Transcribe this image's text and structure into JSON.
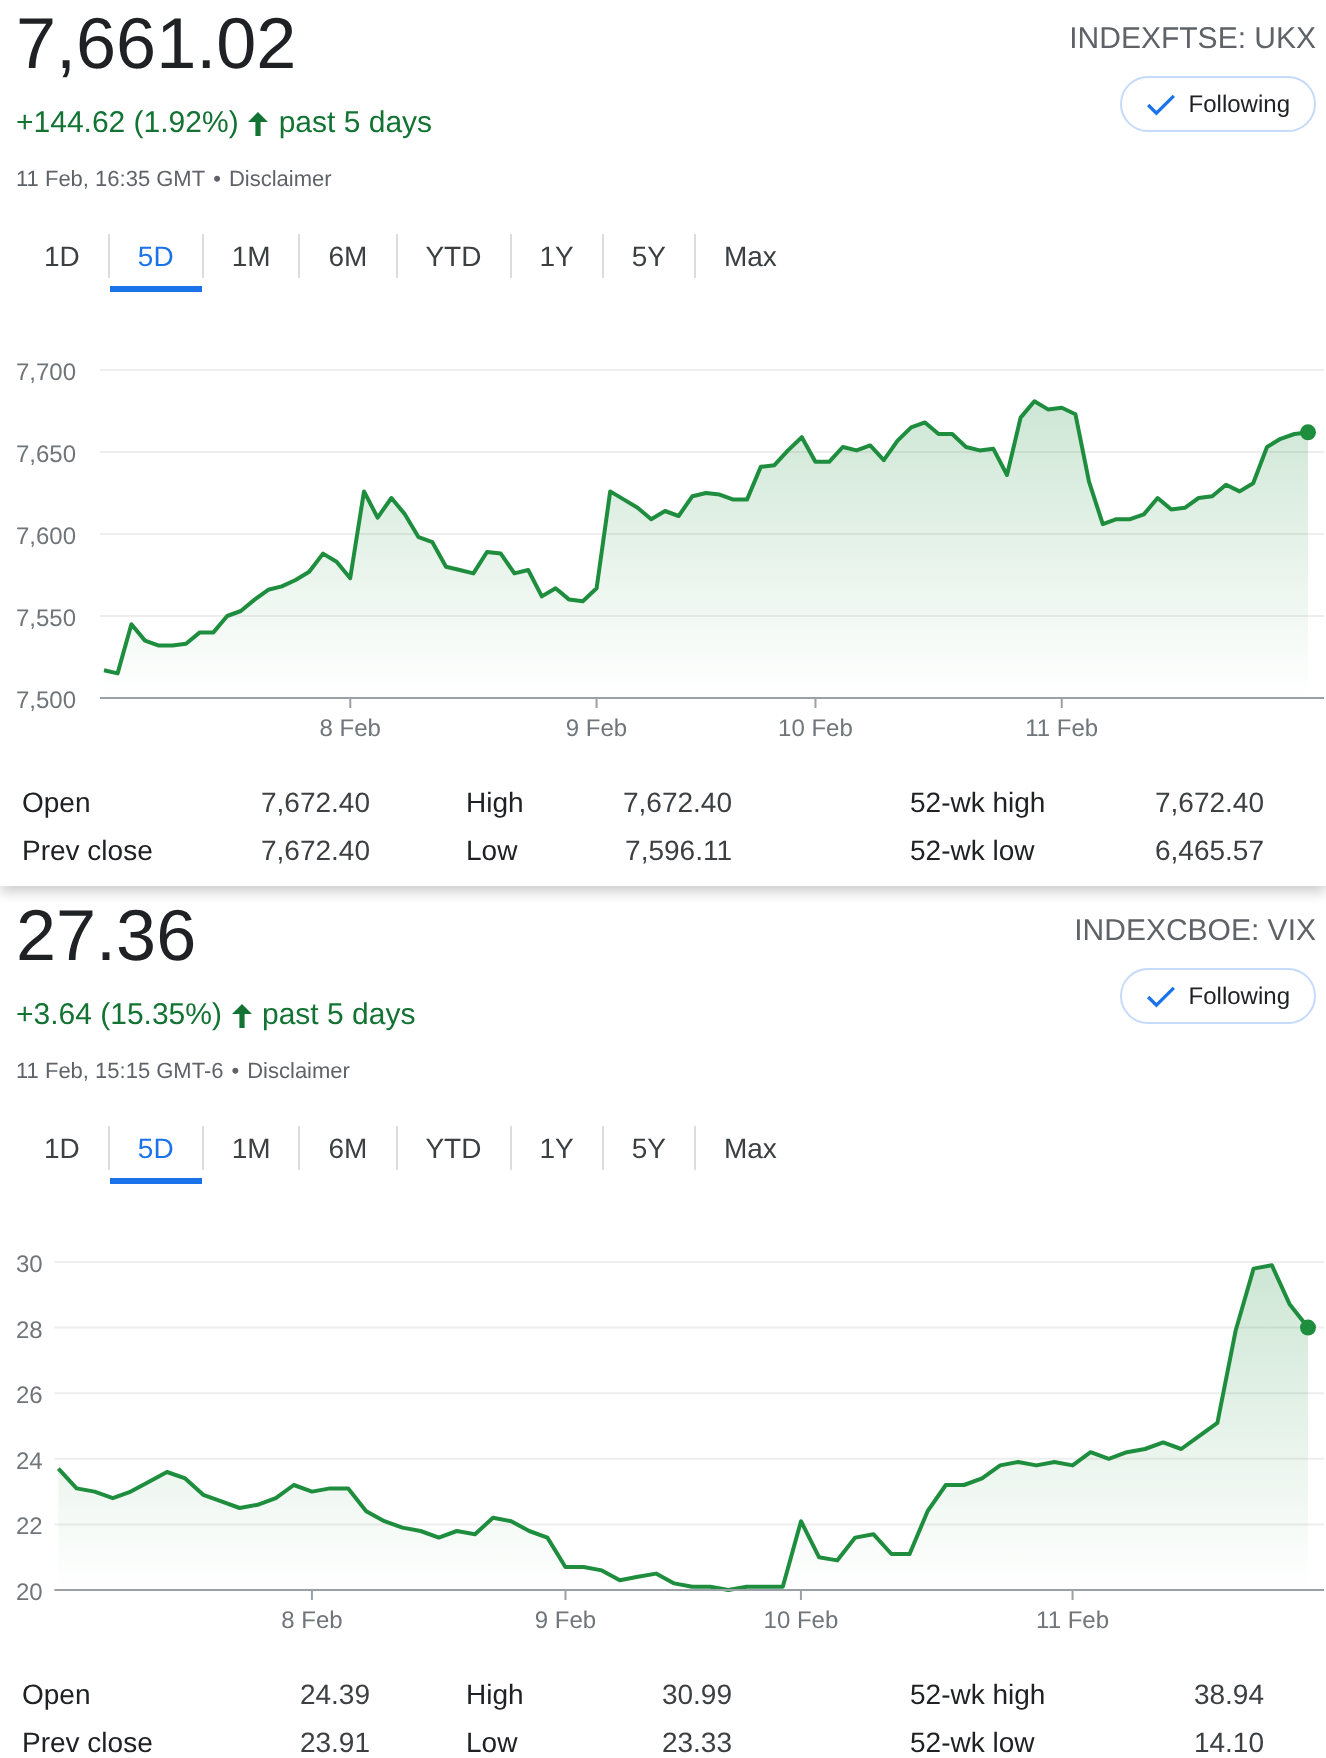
{
  "panels": [
    {
      "price": "7,661.02",
      "ticker": "INDEXFTSE: UKX",
      "follow_button": {
        "label": "Following",
        "following": true
      },
      "change": {
        "text": "+144.62 (1.92%)",
        "rising": true,
        "period": "past 5 days"
      },
      "timestamp": "11 Feb, 16:35 GMT",
      "separator": "•",
      "disclaimer": "Disclaimer",
      "ranges": [
        {
          "label": "1D",
          "selected": false
        },
        {
          "label": "5D",
          "selected": true
        },
        {
          "label": "1M",
          "selected": false
        },
        {
          "label": "6M",
          "selected": false
        },
        {
          "label": "YTD",
          "selected": false
        },
        {
          "label": "1Y",
          "selected": false
        },
        {
          "label": "5Y",
          "selected": false
        },
        {
          "label": "Max",
          "selected": false
        }
      ],
      "chart_data": {
        "type": "area",
        "grid": true,
        "ylim": [
          7500,
          7700
        ],
        "yticks": [
          {
            "value": 7500,
            "label": "7,500"
          },
          {
            "value": 7550,
            "label": "7,550"
          },
          {
            "value": 7600,
            "label": "7,600"
          },
          {
            "value": 7650,
            "label": "7,650"
          },
          {
            "value": 7700,
            "label": "7,700"
          }
        ],
        "categories": [
          null,
          null,
          null,
          null,
          null,
          null,
          null,
          null,
          null,
          null,
          null,
          null,
          null,
          null,
          null,
          null,
          null,
          null,
          "8 Feb",
          null,
          null,
          null,
          null,
          null,
          null,
          null,
          null,
          null,
          null,
          null,
          null,
          null,
          null,
          null,
          null,
          null,
          "9 Feb",
          null,
          null,
          null,
          null,
          null,
          null,
          null,
          null,
          null,
          null,
          null,
          null,
          null,
          null,
          null,
          "10 Feb",
          null,
          null,
          null,
          null,
          null,
          null,
          null,
          null,
          null,
          null,
          null,
          null,
          null,
          null,
          null,
          null,
          null,
          "11 Feb",
          null,
          null,
          null,
          null,
          null,
          null,
          null,
          null,
          null,
          null,
          null,
          null,
          null,
          null,
          null,
          null,
          null,
          null
        ],
        "series": [
          {
            "color": "#1e8e3e",
            "values": [
              7517,
              7515,
              7545,
              7535,
              7532,
              7532,
              7533,
              7540,
              7540,
              7550,
              7553,
              7560,
              7566,
              7568,
              7572,
              7577,
              7588,
              7583,
              7573,
              7626,
              7610,
              7622,
              7612,
              7598,
              7595,
              7580,
              7578,
              7576,
              7589,
              7588,
              7576,
              7578,
              7562,
              7567,
              7560,
              7559,
              7567,
              7626,
              7621,
              7616,
              7609,
              7614,
              7611,
              7623,
              7625,
              7624,
              7621,
              7621,
              7641,
              7642,
              7651,
              7659,
              7644,
              7644,
              7653,
              7651,
              7654,
              7645,
              7657,
              7665,
              7668,
              7661,
              7661,
              7653,
              7651,
              7652,
              7636,
              7671,
              7681,
              7676,
              7677,
              7673,
              7632,
              7606,
              7609,
              7609,
              7612,
              7622,
              7615,
              7616,
              7622,
              7623,
              7630,
              7626,
              7631,
              7653,
              7658,
              7661,
              7662
            ]
          }
        ]
      },
      "stats": [
        [
          {
            "label": "Open",
            "value": "7,672.40"
          },
          {
            "label": "High",
            "value": "7,672.40"
          },
          {
            "label": "52-wk high",
            "value": "7,672.40"
          }
        ],
        [
          {
            "label": "Prev close",
            "value": "7,672.40"
          },
          {
            "label": "Low",
            "value": "7,596.11"
          },
          {
            "label": "52-wk low",
            "value": "6,465.57"
          }
        ]
      ]
    },
    {
      "price": "27.36",
      "ticker": "INDEXCBOE: VIX",
      "follow_button": {
        "label": "Following",
        "following": true
      },
      "change": {
        "text": "+3.64 (15.35%)",
        "rising": true,
        "period": "past 5 days"
      },
      "timestamp": "11 Feb, 15:15 GMT-6",
      "separator": "•",
      "disclaimer": "Disclaimer",
      "ranges": [
        {
          "label": "1D",
          "selected": false
        },
        {
          "label": "5D",
          "selected": true
        },
        {
          "label": "1M",
          "selected": false
        },
        {
          "label": "6M",
          "selected": false
        },
        {
          "label": "YTD",
          "selected": false
        },
        {
          "label": "1Y",
          "selected": false
        },
        {
          "label": "5Y",
          "selected": false
        },
        {
          "label": "Max",
          "selected": false
        }
      ],
      "chart_data": {
        "type": "area",
        "grid": true,
        "ylim": [
          20,
          30
        ],
        "yticks": [
          {
            "value": 20,
            "label": "20"
          },
          {
            "value": 22,
            "label": "22"
          },
          {
            "value": 24,
            "label": "24"
          },
          {
            "value": 26,
            "label": "26"
          },
          {
            "value": 28,
            "label": "28"
          },
          {
            "value": 30,
            "label": "30"
          }
        ],
        "categories": [
          null,
          null,
          null,
          null,
          null,
          null,
          null,
          null,
          null,
          null,
          null,
          null,
          null,
          null,
          "8 Feb",
          null,
          null,
          null,
          null,
          null,
          null,
          null,
          null,
          null,
          null,
          null,
          null,
          null,
          "9 Feb",
          null,
          null,
          null,
          null,
          null,
          null,
          null,
          null,
          null,
          null,
          null,
          null,
          "10 Feb",
          null,
          null,
          null,
          null,
          null,
          null,
          null,
          null,
          null,
          null,
          null,
          null,
          null,
          null,
          "11 Feb",
          null,
          null,
          null,
          null,
          null,
          null,
          null,
          null,
          null,
          null,
          null,
          null,
          null
        ],
        "series": [
          {
            "color": "#1e8e3e",
            "values": [
              23.7,
              23.1,
              23.0,
              22.8,
              23.0,
              23.3,
              23.6,
              23.4,
              22.9,
              22.7,
              22.5,
              22.6,
              22.8,
              23.2,
              23.0,
              23.1,
              23.1,
              22.4,
              22.1,
              21.9,
              21.8,
              21.6,
              21.8,
              21.7,
              22.2,
              22.1,
              21.8,
              21.6,
              20.7,
              20.7,
              20.6,
              20.3,
              20.4,
              20.5,
              20.2,
              20.1,
              20.1,
              20.0,
              20.1,
              20.1,
              20.1,
              22.1,
              21.0,
              20.9,
              21.6,
              21.7,
              21.1,
              21.1,
              22.4,
              23.2,
              23.2,
              23.4,
              23.8,
              23.9,
              23.8,
              23.9,
              23.8,
              24.2,
              24.0,
              24.2,
              24.3,
              24.5,
              24.3,
              24.7,
              25.1,
              27.9,
              29.8,
              29.9,
              28.7,
              28.0
            ]
          }
        ]
      },
      "stats": [
        [
          {
            "label": "Open",
            "value": "24.39"
          },
          {
            "label": "High",
            "value": "30.99"
          },
          {
            "label": "52-wk high",
            "value": "38.94"
          }
        ],
        [
          {
            "label": "Prev close",
            "value": "23.91"
          },
          {
            "label": "Low",
            "value": "23.33"
          },
          {
            "label": "52-wk low",
            "value": "14.10"
          }
        ]
      ]
    }
  ]
}
